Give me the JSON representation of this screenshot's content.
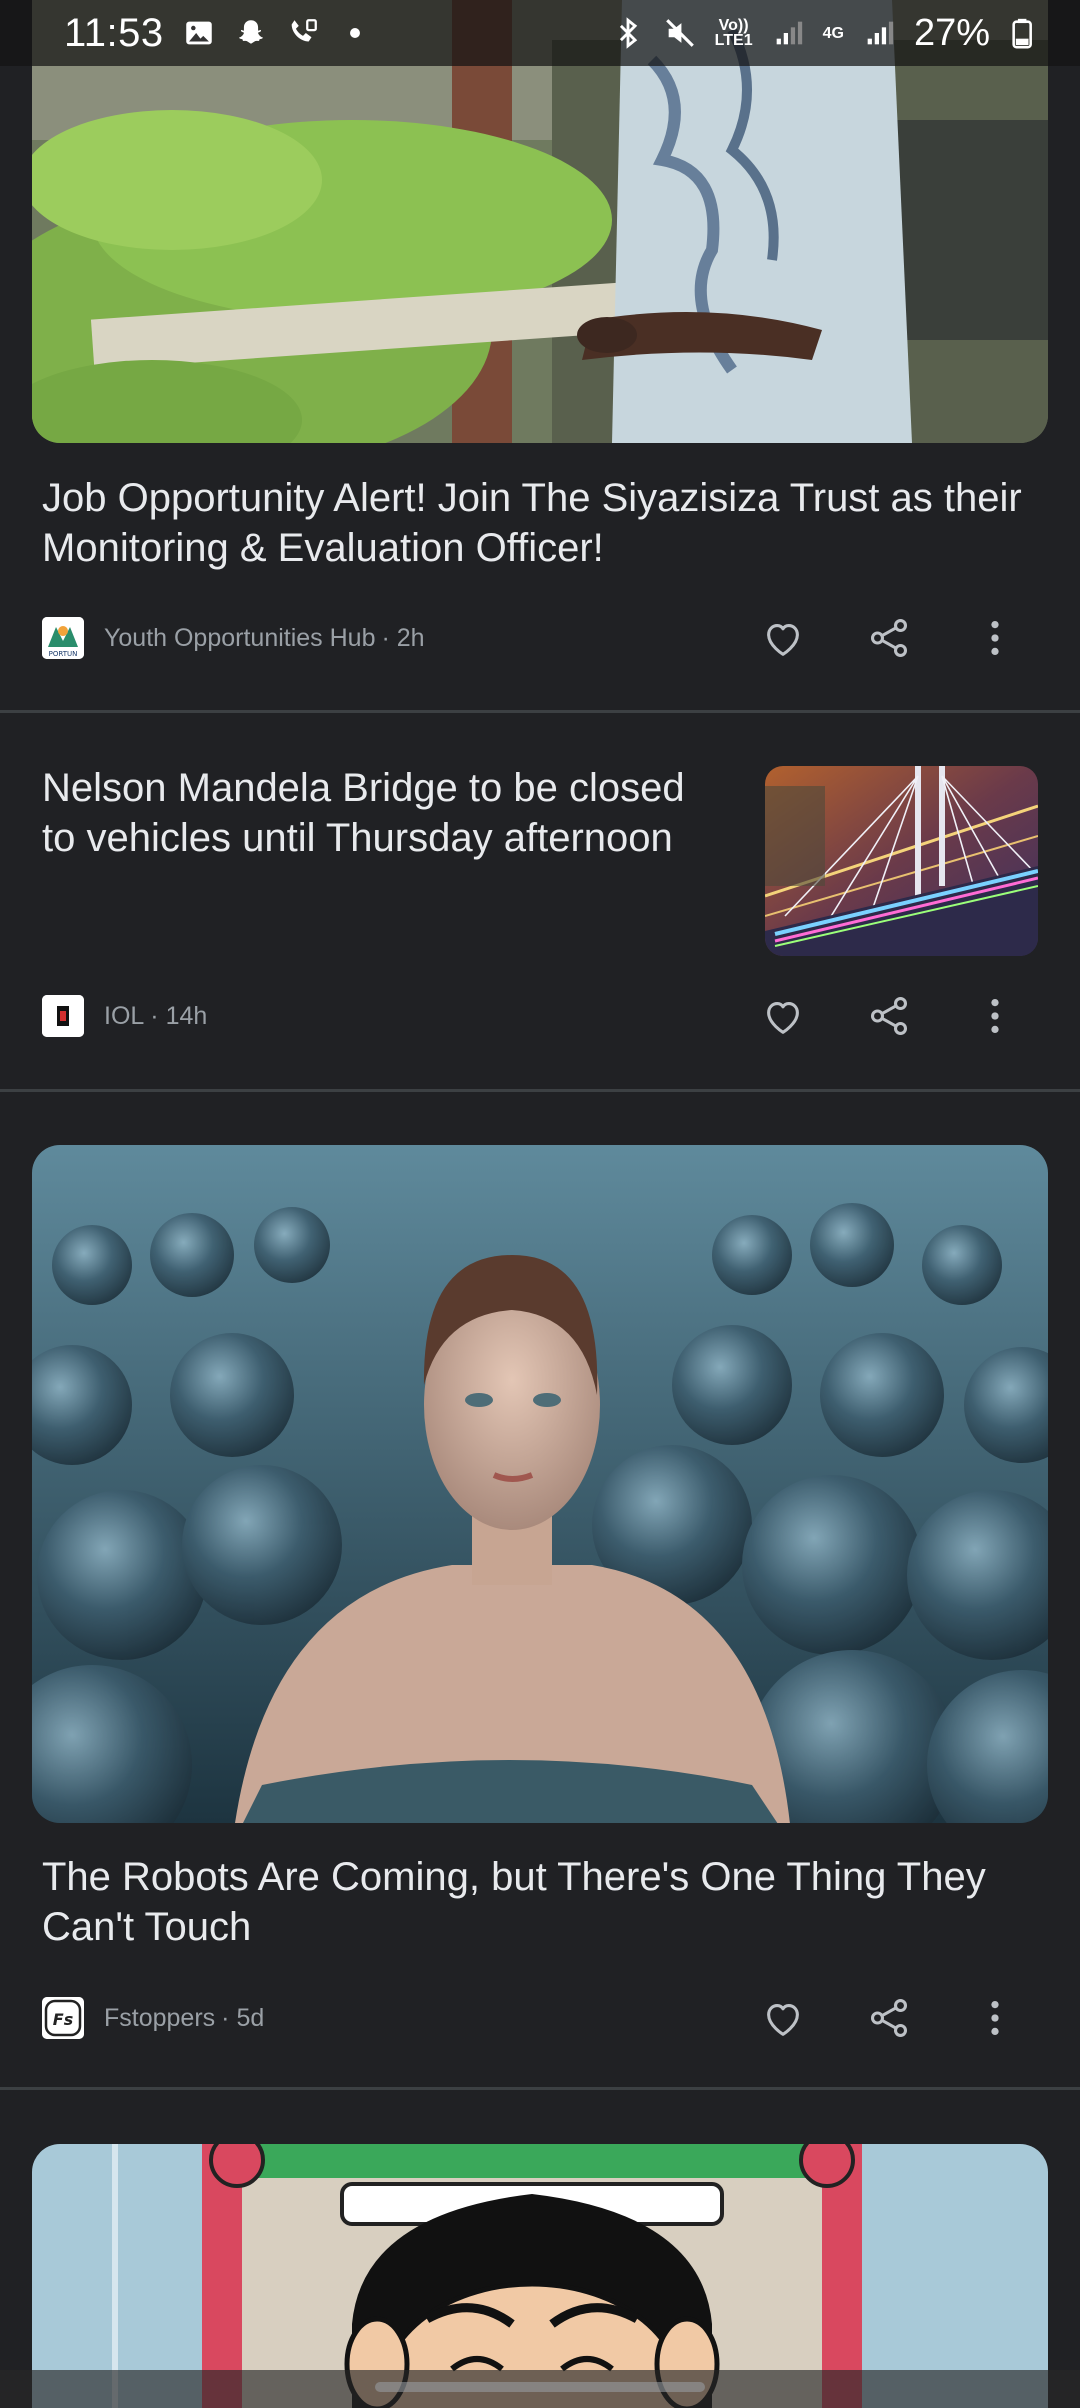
{
  "status_bar": {
    "time": "11:53",
    "network_volte": "Vo))",
    "network_lte": "LTE1",
    "network_4g": "4G",
    "battery": "27%"
  },
  "feed": [
    {
      "headline": "Job Opportunity Alert! Join The Siyazisiza Trust as their Monitoring & Evaluation Officer!",
      "publisher": "Youth Opportunities Hub",
      "age": "· 2h",
      "logo_text": "PORTUN"
    },
    {
      "headline": "Nelson Mandela Bridge to be closed to vehicles until Thursday afternoon",
      "publisher": "IOL",
      "age": "· 14h"
    },
    {
      "headline": "The Robots Are Coming, but There's One Thing They Can't Touch",
      "publisher": "Fstoppers",
      "age": "· 5d",
      "logo_text": "Fs"
    }
  ],
  "colors": {
    "background": "#202124",
    "text_primary": "#e8eaed",
    "text_secondary": "#9aa0a6",
    "divider": "#3c4043"
  }
}
